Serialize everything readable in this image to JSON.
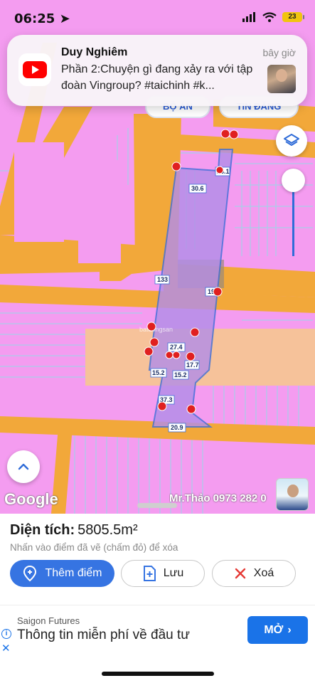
{
  "status_bar": {
    "time": "06:25",
    "battery": "23"
  },
  "notification": {
    "app": "YouTube",
    "title": "Duy Nghiêm",
    "time": "bây giờ",
    "body": "Phần 2:Chuyện gì đang xảy ra với tập đoàn Vingroup? #taichinh #k..."
  },
  "map": {
    "top_buttons": [
      "BỘ ÁN",
      "TIN ĐĂNG"
    ],
    "google_logo": "Google",
    "watermark": "Mr.Thảo 0973 282 0",
    "center_watermark": "batdongsan",
    "measurements": [
      "26.1",
      "30.6",
      "133",
      "198",
      "27.4",
      "17.7",
      "15.2",
      "15.2",
      "37.3",
      "20.9"
    ],
    "colors": {
      "land": "#f49cf0",
      "road": "#f2a83a",
      "polygon_fill": "#b38ee8",
      "polygon_stroke": "#3f6fd8",
      "pin": "#e02020"
    }
  },
  "panel": {
    "area_label": "Diện tích:",
    "area_value": "5805.5m²",
    "hint": "Nhấn vào điểm đã vẽ (chấm đỏ) để xóa",
    "buttons": {
      "add": "Thêm điểm",
      "save": "Lưu",
      "delete": "Xoá"
    }
  },
  "ad": {
    "source": "Saigon Futures",
    "title": "Thông tin miễn phí về đầu tư",
    "cta": "MỞ"
  }
}
